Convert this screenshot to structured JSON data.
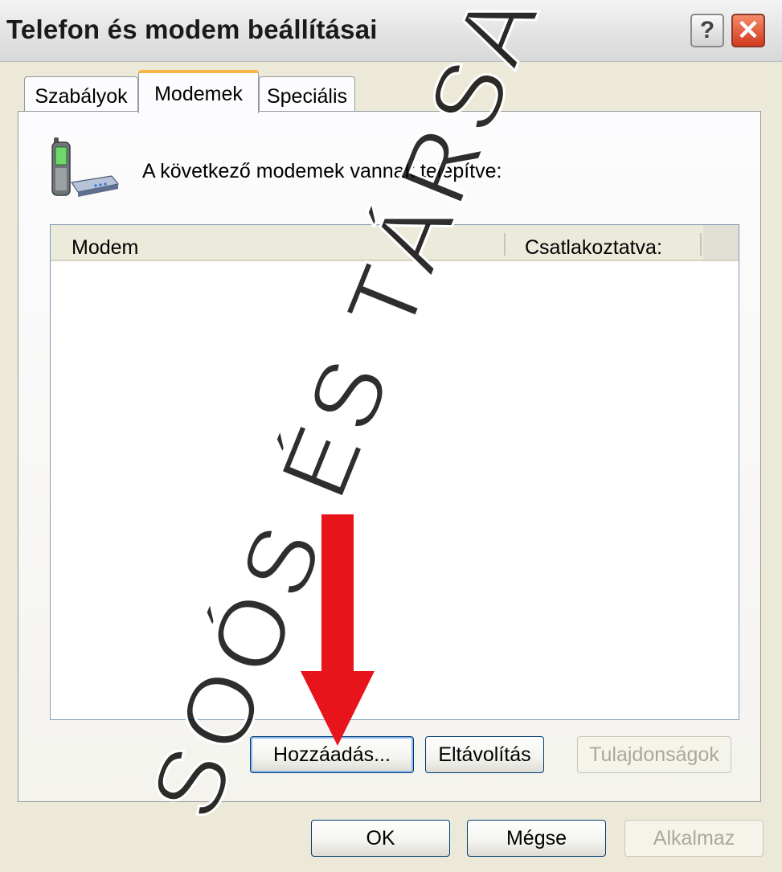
{
  "window": {
    "title": "Telefon és modem beállításai",
    "help_glyph": "?",
    "close_glyph": "✕"
  },
  "tabs": [
    {
      "label": "Szabályok",
      "active": false
    },
    {
      "label": "Modemek",
      "active": true
    },
    {
      "label": "Speciális",
      "active": false
    }
  ],
  "panel": {
    "icon": "phone-modem-icon",
    "intro_text": "A következő modemek vannak telepítve:",
    "list": {
      "columns": [
        "Modem",
        "Csatlakoztatva:"
      ],
      "rows": []
    },
    "buttons": {
      "add": "Hozzáadás...",
      "remove": "Eltávolítás",
      "properties": "Tulajdonságok"
    }
  },
  "footer": {
    "ok": "OK",
    "cancel": "Mégse",
    "apply": "Alkalmaz"
  },
  "overlay": {
    "watermark": "SOÓS ÉS TÁRSA",
    "arrow_color": "#e8141c"
  },
  "colors": {
    "accent_tab": "#f8b544",
    "button_border": "#003c74",
    "disabled_text": "#aca899"
  }
}
